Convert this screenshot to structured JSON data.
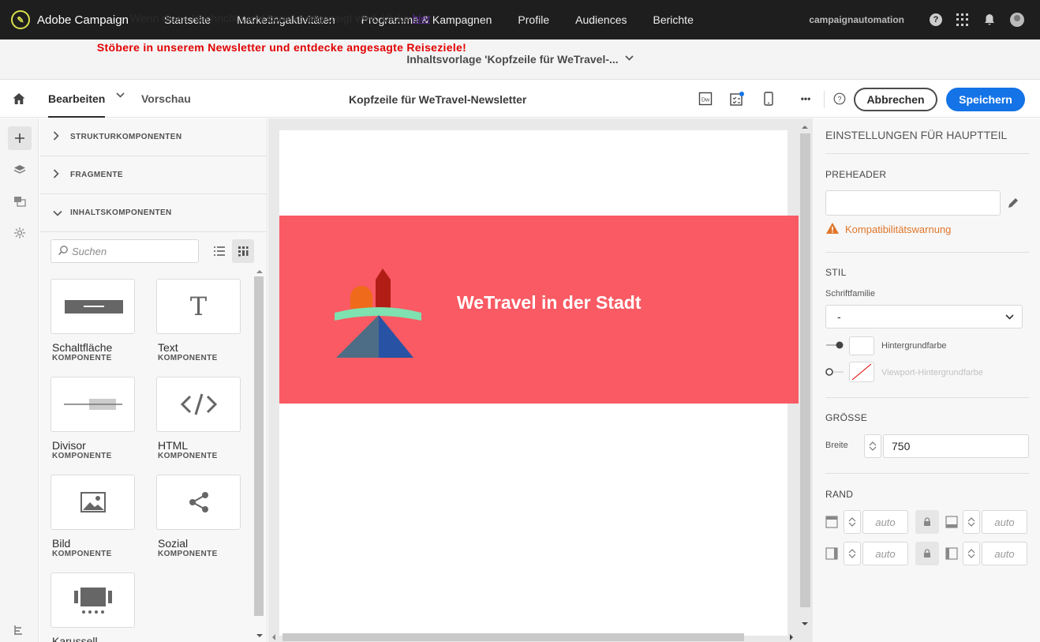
{
  "app": {
    "name": "Adobe Campaign",
    "user": "campaignautomation"
  },
  "topnav": [
    "Startseite",
    "Marketingaktivitäten",
    "Programme & Kampagnen",
    "Profile",
    "Audiences",
    "Berichte"
  ],
  "titlebar": {
    "title": "Inhaltsvorlage 'Kopfzeile für WeTravel-..."
  },
  "toolbar": {
    "tab_edit": "Bearbeiten",
    "tab_preview": "Vorschau",
    "document_title": "Kopfzeile für WeTravel-Newsletter",
    "cancel_label": "Abbrechen",
    "save_label": "Speichern",
    "dw_label": "Dw",
    "more_label": "•••"
  },
  "components": {
    "sections": [
      "STRUKTURKOMPONENTEN",
      "FRAGMENTE",
      "INHALTSKOMPONENTEN"
    ],
    "search_placeholder": "Suchen",
    "items": [
      {
        "name": "Schaltfläche",
        "type": "KOMPONENTE"
      },
      {
        "name": "Text",
        "type": "KOMPONENTE"
      },
      {
        "name": "Divisor",
        "type": "KOMPONENTE"
      },
      {
        "name": "HTML",
        "type": "KOMPONENTE"
      },
      {
        "name": "Bild",
        "type": "KOMPONENTE"
      },
      {
        "name": "Sozial",
        "type": "KOMPONENTE"
      },
      {
        "name": "Karussell",
        "type": ""
      }
    ]
  },
  "email": {
    "preheader_text": "Wenn diese Nachricht nicht korrekt angezeigt wird, klicke",
    "preheader_link": "hier",
    "preheader_end": ".",
    "promo": "Stöbere in unserem Newsletter und entdecke angesagte Reiseziele!",
    "hero_title": "WeTravel in der Stadt",
    "hero_color": "#f95a63",
    "promo_color": "#e00000"
  },
  "settings": {
    "title": "EINSTELLUNGEN FÜR HAUPTTEIL",
    "preheader_label": "PREHEADER",
    "preheader_value": "",
    "warning": "Kompatibilitätswarnung",
    "style_label": "STIL",
    "font_family_label": "Schriftfamilie",
    "font_family_value": "-",
    "bg_color_label": "Hintergrundfarbe",
    "viewport_bg_label": "Viewport-Hintergrundfarbe",
    "size_label": "GRÖSSE",
    "width_label": "Breite",
    "width_value": "750",
    "margin_label": "RAND",
    "margin_placeholder": "auto"
  },
  "colors": {
    "accent": "#1473e6",
    "topbar": "#1e1e1e",
    "warning": "#e0762a"
  }
}
